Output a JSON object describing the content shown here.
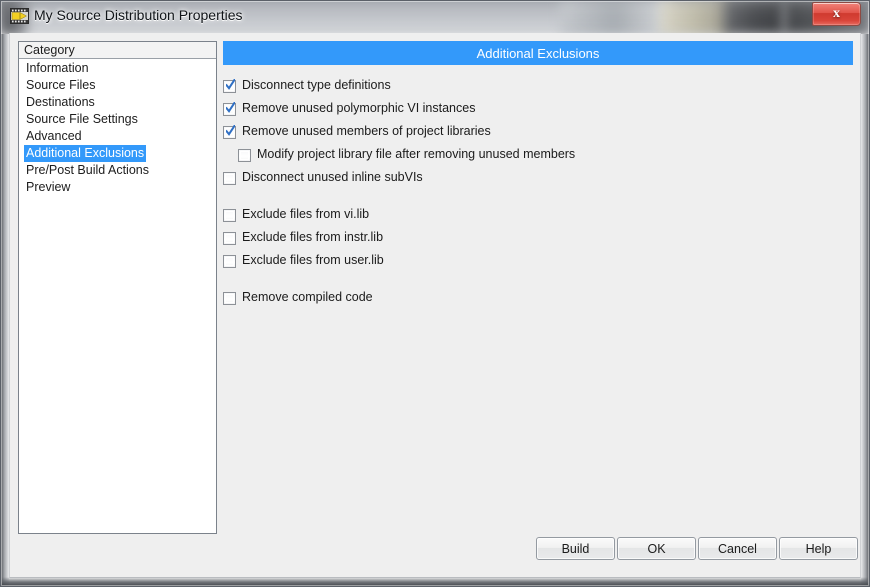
{
  "window": {
    "title": "My Source Distribution Properties",
    "icon": "labview-source-distribution-icon",
    "close_label": "x"
  },
  "sidebar": {
    "header": "Category",
    "items": [
      {
        "label": "Information",
        "selected": false
      },
      {
        "label": "Source Files",
        "selected": false
      },
      {
        "label": "Destinations",
        "selected": false
      },
      {
        "label": "Source File Settings",
        "selected": false
      },
      {
        "label": "Advanced",
        "selected": false
      },
      {
        "label": "Additional Exclusions",
        "selected": true
      },
      {
        "label": "Pre/Post Build Actions",
        "selected": false
      },
      {
        "label": "Preview",
        "selected": false
      }
    ]
  },
  "content": {
    "header": "Additional Exclusions",
    "header_color": "#3399fa",
    "options": [
      {
        "label": "Disconnect type definitions",
        "checked": true,
        "indent": false,
        "spacer_before": false
      },
      {
        "label": "Remove unused polymorphic VI instances",
        "checked": true,
        "indent": false,
        "spacer_before": false
      },
      {
        "label": "Remove unused members of project libraries",
        "checked": true,
        "indent": false,
        "spacer_before": false
      },
      {
        "label": "Modify project library file after removing unused members",
        "checked": false,
        "indent": true,
        "spacer_before": false
      },
      {
        "label": "Disconnect unused inline subVIs",
        "checked": false,
        "indent": false,
        "spacer_before": false
      },
      {
        "label": "Exclude files from vi.lib",
        "checked": false,
        "indent": false,
        "spacer_before": true
      },
      {
        "label": "Exclude files from instr.lib",
        "checked": false,
        "indent": false,
        "spacer_before": false
      },
      {
        "label": "Exclude files from user.lib",
        "checked": false,
        "indent": false,
        "spacer_before": false
      },
      {
        "label": "Remove compiled code",
        "checked": false,
        "indent": false,
        "spacer_before": true
      }
    ]
  },
  "buttons": {
    "build": "Build",
    "ok": "OK",
    "cancel": "Cancel",
    "help": "Help"
  }
}
